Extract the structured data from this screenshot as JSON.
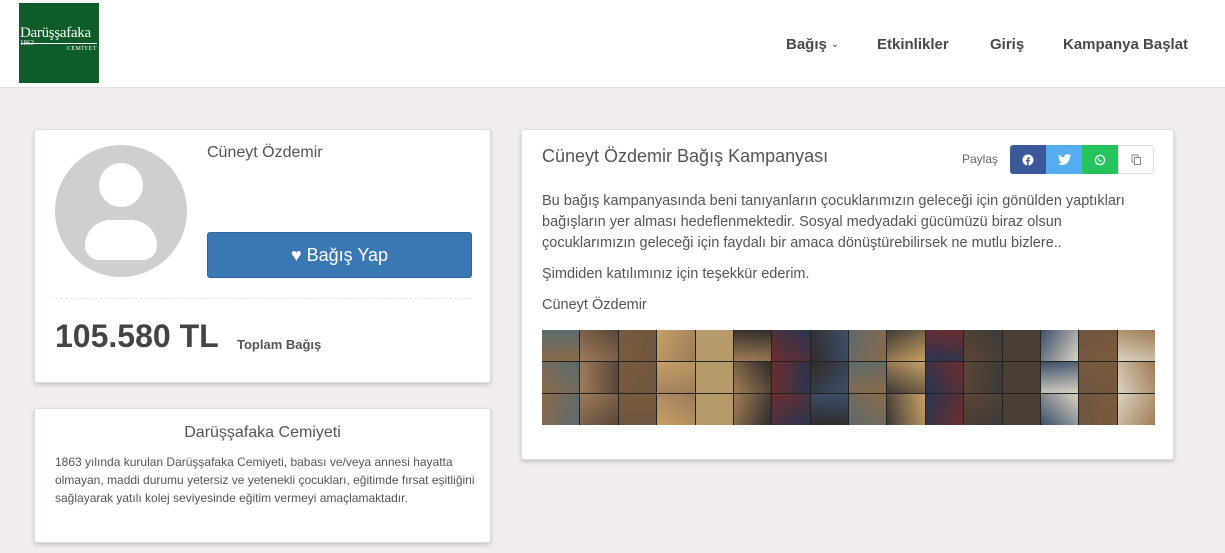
{
  "logo": {
    "name": "Darüşşafaka",
    "year": "1863",
    "subtitle": "CEMİYET"
  },
  "nav": [
    {
      "label": "Bağış",
      "has_dropdown": true
    },
    {
      "label": "Etkinlikler",
      "has_dropdown": false
    },
    {
      "label": "Giriş",
      "has_dropdown": false
    },
    {
      "label": "Kampanya Başlat",
      "has_dropdown": false
    }
  ],
  "profile": {
    "name": "Cüneyt Özdemir",
    "donate_label": "Bağış Yap",
    "total_amount": "105.580 TL",
    "total_label": "Toplam Bağış"
  },
  "organization": {
    "title": "Darüşşafaka Cemiyeti",
    "description": "1863 yılında kurulan Darüşşafaka Cemiyeti, babası ve/veya annesi hayatta olmayan, maddi durumu yetersiz ve yetenekli çocukları, eğitimde fırsat eşitliğini sağlayarak yatılı kolej seviyesinde eğitim vermeyi amaçlamaktadır."
  },
  "campaign": {
    "title": "Cüneyt Özdemir Bağış Kampanyası",
    "share_label": "Paylaş",
    "share_buttons": [
      {
        "icon": "facebook-icon",
        "color": "#3b5998"
      },
      {
        "icon": "twitter-icon",
        "color": "#55acee"
      },
      {
        "icon": "whatsapp-icon",
        "color": "#25c35c"
      },
      {
        "icon": "copy-icon",
        "color": "#ffffff"
      }
    ],
    "paragraphs": [
      "Bu bağış kampanyasında beni tanıyanların çocuklarımızın geleceği için gönülden yaptıkları bağışların yer alması hedeflenmektedir. Sosyal medyadaki gücümüzü biraz olsun çocuklarımızın geleceği için faydalı bir amaca dönüştürebilirsek ne mutlu bizlere..",
      "Şimdiden katılımınız için teşekkür ederim.",
      "Cüneyt Özdemir"
    ]
  },
  "colors": {
    "brand_green": "#0d5c2a",
    "primary_blue": "#3a78b5",
    "page_background": "#f3eeee"
  }
}
